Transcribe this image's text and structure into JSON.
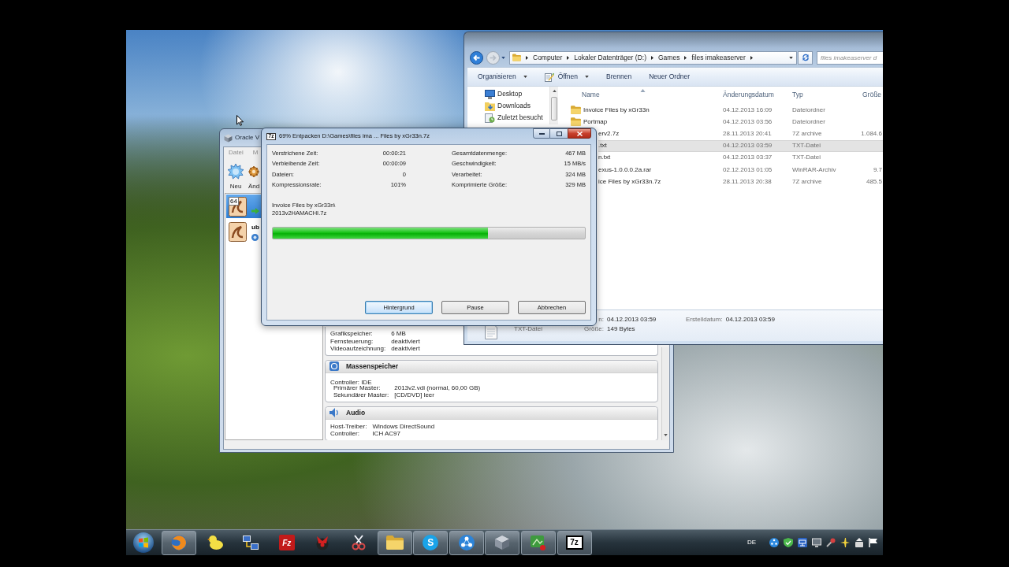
{
  "explorer_window": {
    "breadcrumb": [
      "Computer",
      "Lokaler Datenträger (D:)",
      "Games",
      "files imakeaserver"
    ],
    "search": {
      "placeholder": "files imakeaserver d"
    },
    "toolbar": [
      {
        "label": "Organisieren",
        "has_icon": false,
        "dropdown": true
      },
      {
        "label": "Öffnen",
        "has_icon": true,
        "dropdown": true
      },
      {
        "label": "Brennen",
        "has_icon": false,
        "dropdown": false
      },
      {
        "label": "Neuer Ordner",
        "has_icon": false,
        "dropdown": false
      }
    ],
    "nav": [
      {
        "kind": "desktop",
        "label": "Desktop"
      },
      {
        "kind": "downloads",
        "label": "Downloads"
      },
      {
        "kind": "recent",
        "label": "Zuletzt besucht"
      }
    ],
    "columns": [
      {
        "label": "Name",
        "sorted": true
      },
      {
        "label": "Änderungsdatum",
        "sorted": false
      },
      {
        "label": "Typ",
        "sorted": false
      },
      {
        "label": "Größe",
        "sorted": false
      }
    ],
    "files": [
      {
        "kind": "folder",
        "name": "Invoice Files by xGr33n",
        "date": "04.12.2013 16:09",
        "type": "Dateiordner",
        "selected": false
      },
      {
        "kind": "folder",
        "name": "Portmap",
        "date": "04.12.2013 03:56",
        "type": "Dateiordner",
        "selected": false
      },
      {
        "kind": "file",
        "name": "erv2.7z",
        "date": "28.11.2013 20:41",
        "type": "7Z archive",
        "size": "1.084.6",
        "selected": false
      },
      {
        "kind": "file",
        "name": ".txt",
        "date": "04.12.2013 03:59",
        "type": "TXT-Datei",
        "selected": true
      },
      {
        "kind": "file",
        "name": "n.txt",
        "date": "04.12.2013 03:37",
        "type": "TXT-Datei",
        "selected": false
      },
      {
        "kind": "file",
        "name": "exus-1.0.0.0.2a.rar",
        "date": "02.12.2013 01:05",
        "type": "WinRAR-Archiv",
        "size": "9.7",
        "selected": false
      },
      {
        "kind": "file",
        "name": "ice Files by xGr33n.7z",
        "date": "28.11.2013 20:38",
        "type": "7Z archive",
        "size": "485.5",
        "selected": false
      }
    ],
    "details": {
      "modified_label": "n:",
      "modified": "04.12.2013 03:59",
      "created_label": "Erstelldatum:",
      "created": "04.12.2013 03:59",
      "type": "TXT-Datei",
      "size_label": "Größe:",
      "size": "149 Bytes"
    }
  },
  "virtualbox_window": {
    "title": "Oracle V",
    "menu": [
      "Datei",
      "M"
    ],
    "toolbar": [
      {
        "kind": "new",
        "label": "Neu"
      },
      {
        "kind": "settings",
        "label": "Änd"
      }
    ],
    "vm_list": [
      {
        "kind": "running",
        "badge": "64",
        "selected": true
      },
      {
        "kind": "saved",
        "label": "ub",
        "selected": false
      }
    ],
    "details": [
      {
        "kind": "continued",
        "rows": [
          {
            "label": "Grafikspeicher:",
            "value": "6 MB"
          },
          {
            "label": "Fernsteuerung:",
            "value": "deaktiviert"
          },
          {
            "label": "Videoaufzeichnung:",
            "value": "deaktiviert"
          }
        ]
      },
      {
        "kind": "storage",
        "title": "Massenspeicher",
        "rows": [
          {
            "text": "Controller: IDE",
            "children": [
              {
                "label": "Primärer Master:",
                "value": "2013v2.vdi (normal, 60,00 GB)"
              },
              {
                "label": "Sekundärer Master:",
                "value": "[CD/DVD] leer"
              }
            ]
          }
        ]
      },
      {
        "kind": "audio",
        "title": "Audio",
        "rows": [
          {
            "label": "Host-Treiber:",
            "value": "Windows DirectSound"
          },
          {
            "label": "Controller:",
            "value": "ICH AC97"
          }
        ]
      }
    ]
  },
  "progress_dialog": {
    "icon_label": "7z",
    "title": "69% Entpacken D:\\Games\\files ima ... Files by xGr33n.7z",
    "stat_columns": [
      [
        {
          "label": "Verstrichene Zeit:",
          "value": "00:00:21"
        },
        {
          "label": "Verbleibende Zeit:",
          "value": "00:00:09"
        },
        {
          "label": "Dateien:",
          "value": "0"
        },
        {
          "label": "Kompressionsrate:",
          "value": "101%"
        }
      ],
      [
        {
          "label": "Gesamtdatenmenge:",
          "value": "467 MB"
        },
        {
          "label": "Geschwindigkeit:",
          "value": "15 MB/s"
        },
        {
          "label": "Verarbeitet:",
          "value": "324 MB"
        },
        {
          "label": "Komprimierte Größe:",
          "value": "329 MB"
        }
      ]
    ],
    "current_file": [
      "Invoice Files by xGr33n\\",
      "2013v2HAMACHI.7z"
    ],
    "progress": {
      "level": 0.69
    },
    "buttons": [
      {
        "label": "Hintergrund",
        "focused": true
      },
      {
        "label": "Pause",
        "focused": false
      },
      {
        "label": "Abbrechen",
        "focused": false
      }
    ]
  },
  "taskbar": {
    "items": [
      {
        "kind": "globe",
        "open": true
      },
      {
        "kind": "duck",
        "open": false
      },
      {
        "kind": "network",
        "open": false
      },
      {
        "kind": "letter_tile",
        "label": "Fz",
        "open": false
      },
      {
        "kind": "figure",
        "open": false
      },
      {
        "kind": "scissors",
        "open": false
      },
      {
        "kind": "folder",
        "open": true
      },
      {
        "kind": "letter_circle",
        "label": "S",
        "open": true
      },
      {
        "kind": "dots",
        "open": true
      },
      {
        "kind": "cube",
        "open": true
      },
      {
        "kind": "picture",
        "open": true
      },
      {
        "kind": "letter_box",
        "label": "7z",
        "open": true
      }
    ],
    "language": "DE"
  }
}
